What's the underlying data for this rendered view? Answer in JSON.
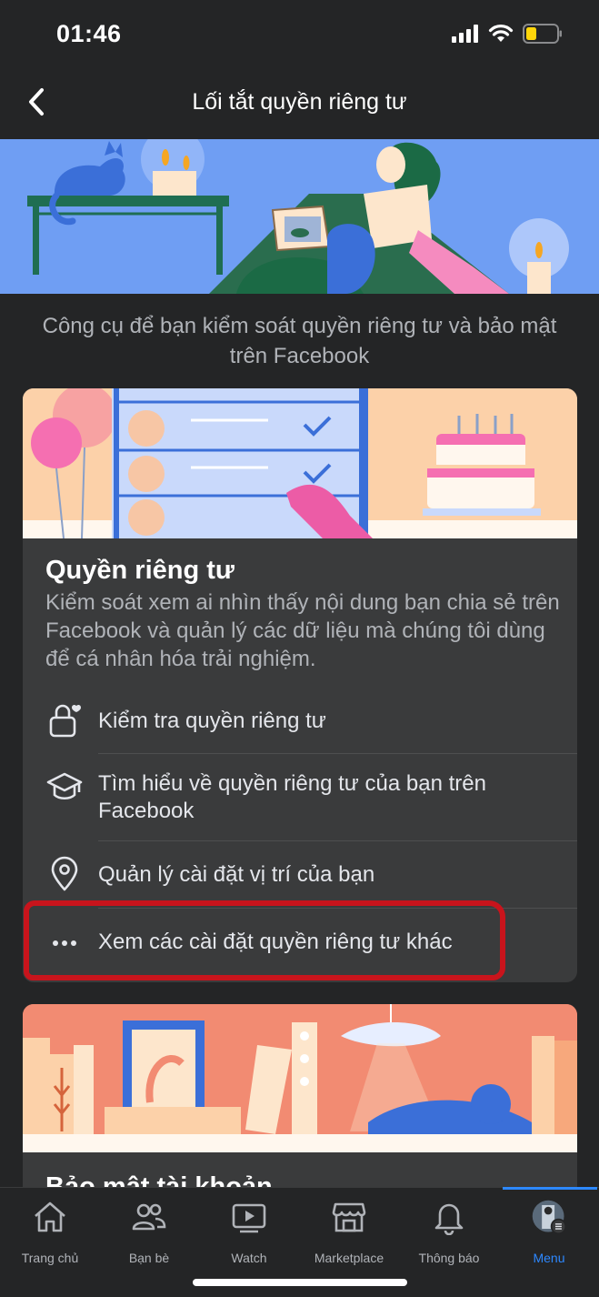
{
  "status_bar": {
    "time": "01:46"
  },
  "header": {
    "title": "Lối tắt quyền riêng tư"
  },
  "intro_text": "Công cụ để bạn kiểm soát quyền riêng tư và bảo mật trên Facebook",
  "privacy_card": {
    "title": "Quyền riêng tư",
    "description": "Kiểm soát xem ai nhìn thấy nội dung bạn chia sẻ trên Facebook và quản lý các dữ liệu mà chúng tôi dùng để cá nhân hóa trải nghiệm.",
    "options": [
      {
        "label": "Kiểm tra quyền riêng tư",
        "icon": "lock-heart-icon"
      },
      {
        "label": "Tìm hiểu về quyền riêng tư của bạn trên Facebook",
        "icon": "graduation-cap-icon"
      },
      {
        "label": "Quản lý cài đặt vị trí của bạn",
        "icon": "location-pin-icon"
      },
      {
        "label": "Xem các cài đặt quyền riêng tư khác",
        "icon": "more-dots-icon"
      }
    ]
  },
  "security_card": {
    "title": "Bảo mật tài khoản"
  },
  "tabbar": {
    "tabs": [
      {
        "label": "Trang chủ",
        "icon": "home-icon"
      },
      {
        "label": "Bạn bè",
        "icon": "friends-icon"
      },
      {
        "label": "Watch",
        "icon": "watch-icon"
      },
      {
        "label": "Marketplace",
        "icon": "marketplace-icon"
      },
      {
        "label": "Thông báo",
        "icon": "bell-icon"
      },
      {
        "label": "Menu",
        "icon": "avatar-icon",
        "active": true
      }
    ]
  },
  "colors": {
    "accent": "#2d88ff",
    "highlight_annotation": "#c8141c",
    "background": "#242526",
    "card": "#3a3b3c"
  }
}
